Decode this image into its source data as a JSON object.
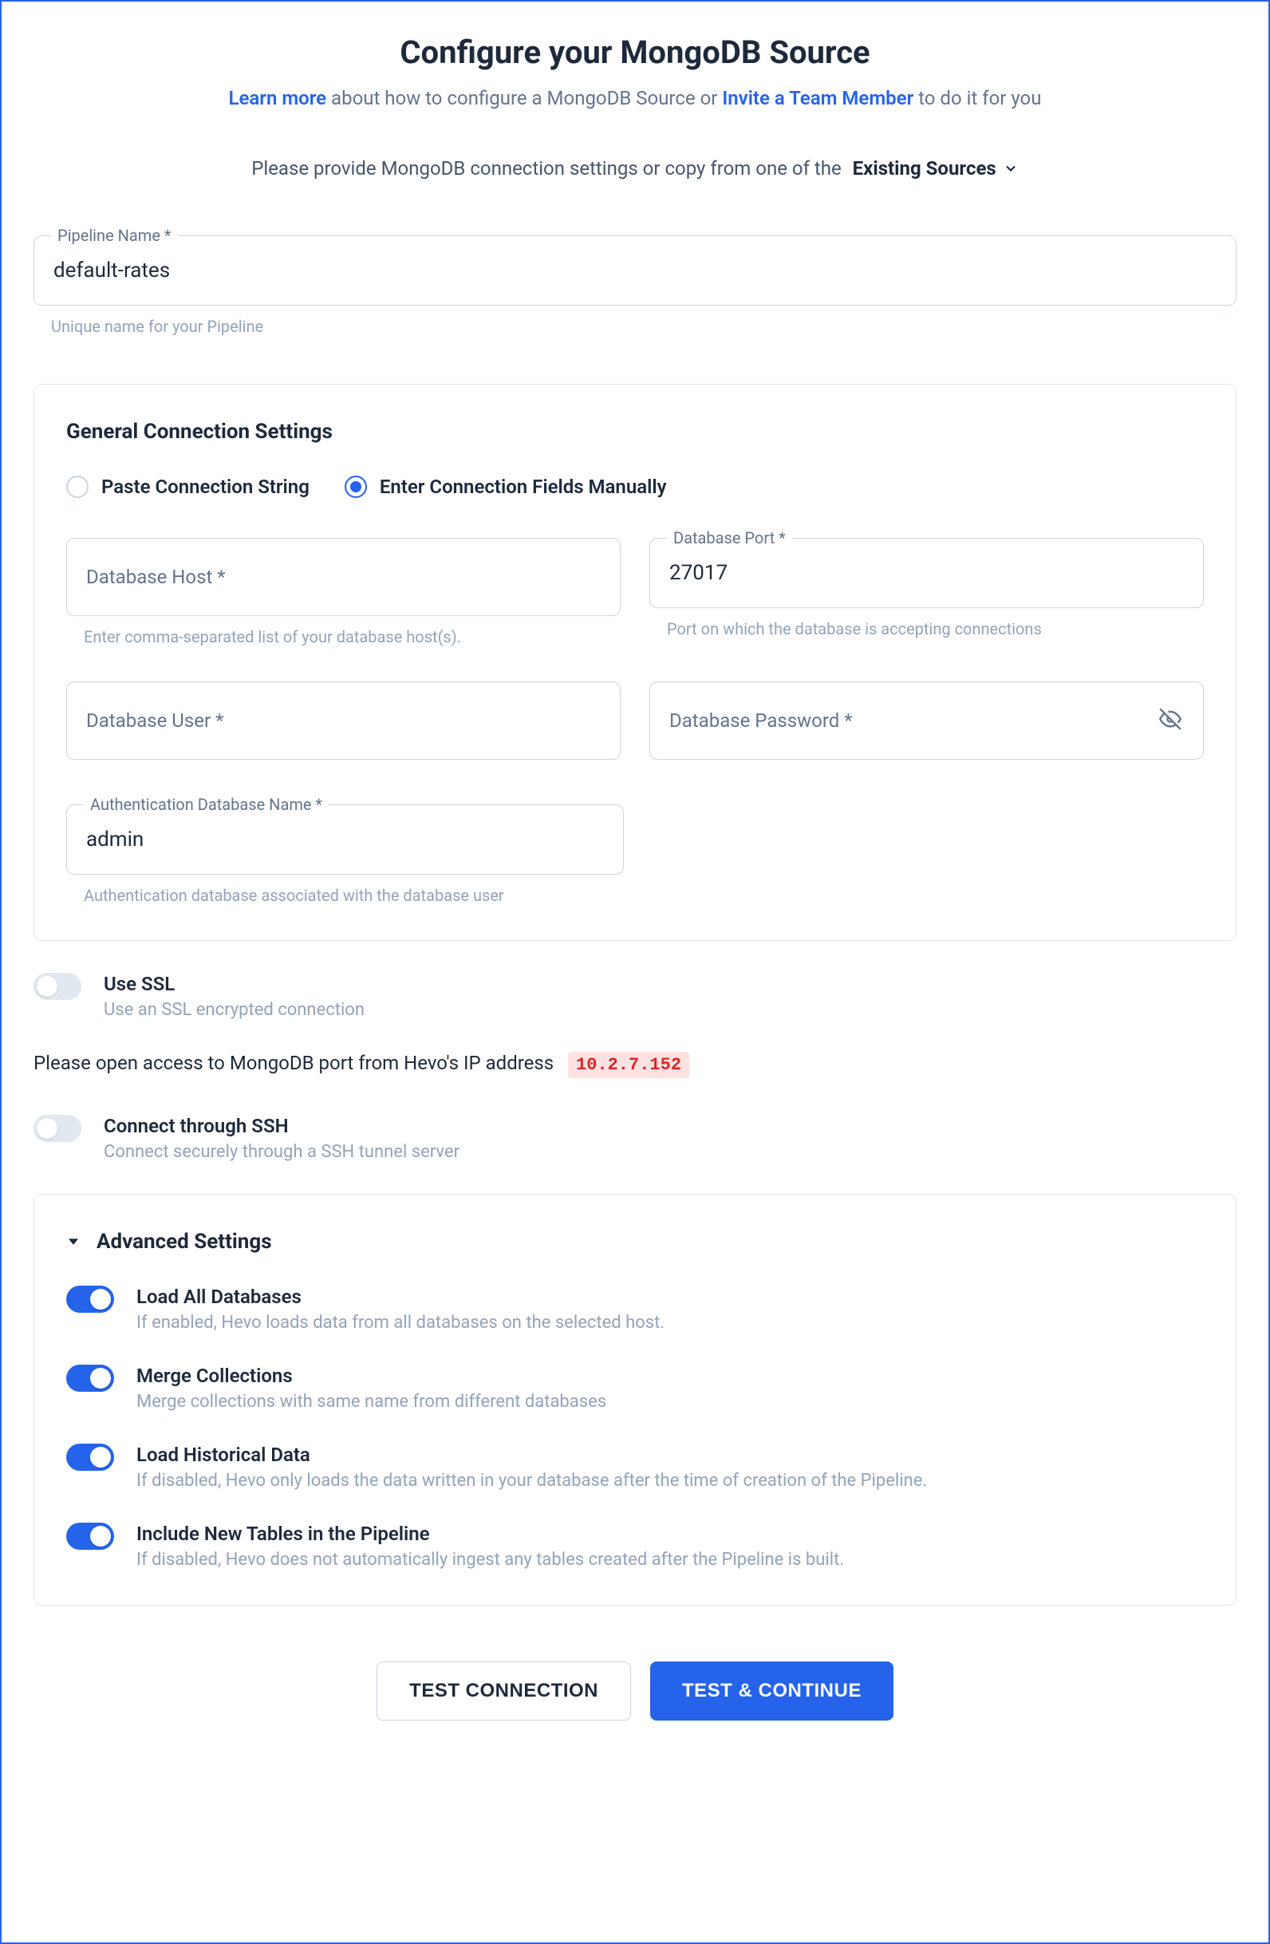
{
  "header": {
    "title": "Configure your MongoDB Source",
    "learn_more": "Learn more",
    "sub_mid": " about how to configure a MongoDB Source or ",
    "invite": "Invite a Team Member",
    "sub_end": " to do it for you"
  },
  "copy_line": {
    "text": "Please provide MongoDB connection settings or copy from one of the",
    "link": "Existing Sources"
  },
  "pipeline": {
    "label": "Pipeline Name *",
    "value": "default-rates",
    "helper": "Unique name for your Pipeline"
  },
  "general": {
    "title": "General Connection Settings",
    "radio_paste": "Paste Connection String",
    "radio_manual": "Enter Connection Fields Manually",
    "host_label": "Database Host *",
    "host_helper": "Enter comma-separated list of your database host(s).",
    "port_label": "Database Port *",
    "port_value": "27017",
    "port_helper": "Port on which the database is accepting connections",
    "user_label": "Database User *",
    "password_label": "Database Password *",
    "authdb_label": "Authentication Database Name *",
    "authdb_value": "admin",
    "authdb_helper": "Authentication database associated with the database user"
  },
  "ssl": {
    "title": "Use SSL",
    "desc": "Use an SSL encrypted connection"
  },
  "ip": {
    "text": "Please open access to MongoDB port from Hevo's IP address",
    "code": "10.2.7.152"
  },
  "ssh": {
    "title": "Connect through SSH",
    "desc": "Connect securely through a SSH tunnel server"
  },
  "advanced": {
    "title": "Advanced Settings",
    "items": [
      {
        "title": "Load All Databases",
        "desc": "If enabled, Hevo loads data from all databases on the selected host."
      },
      {
        "title": "Merge Collections",
        "desc": "Merge collections with same name from different databases"
      },
      {
        "title": "Load Historical Data",
        "desc": "If disabled, Hevo only loads the data written in your database after the time of creation of the Pipeline."
      },
      {
        "title": "Include New Tables in the Pipeline",
        "desc": "If disabled, Hevo does not automatically ingest any tables created after the Pipeline is built."
      }
    ]
  },
  "buttons": {
    "test": "TEST CONNECTION",
    "continue": "TEST & CONTINUE"
  }
}
